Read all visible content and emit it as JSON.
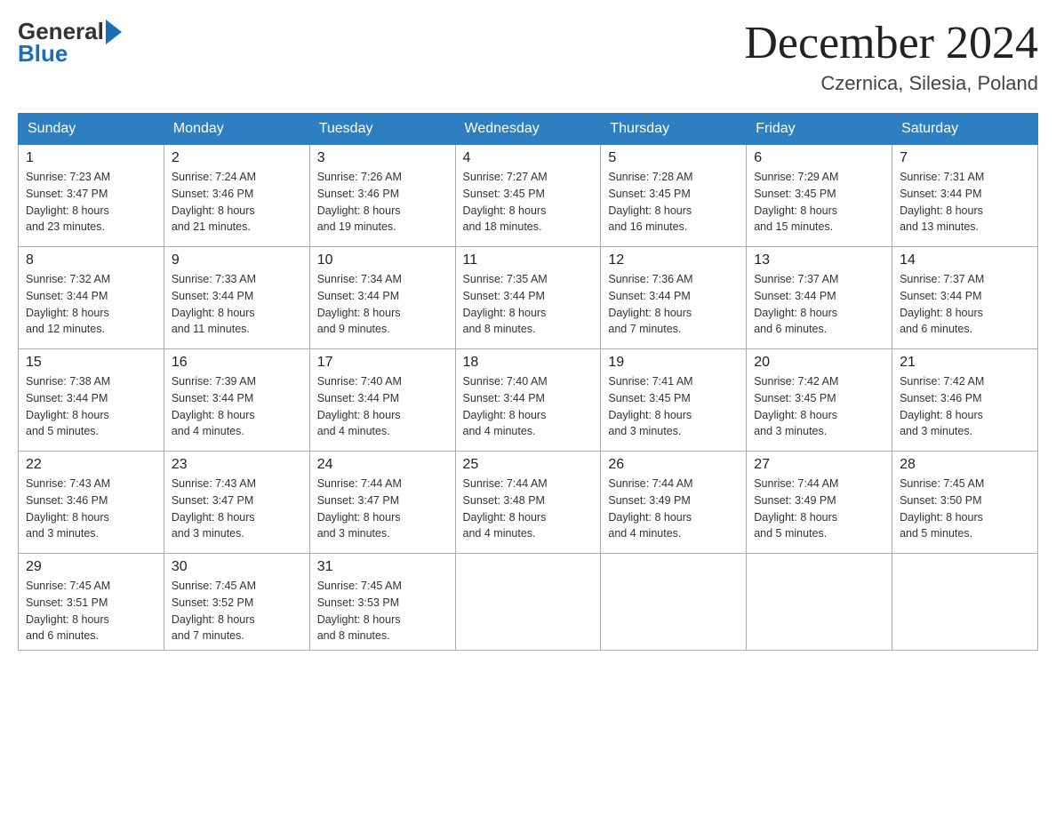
{
  "header": {
    "logo_general": "General",
    "logo_blue": "Blue",
    "title": "December 2024",
    "subtitle": "Czernica, Silesia, Poland"
  },
  "days_of_week": [
    "Sunday",
    "Monday",
    "Tuesday",
    "Wednesday",
    "Thursday",
    "Friday",
    "Saturday"
  ],
  "weeks": [
    [
      {
        "day": "1",
        "sunrise": "7:23 AM",
        "sunset": "3:47 PM",
        "daylight": "8 hours and 23 minutes."
      },
      {
        "day": "2",
        "sunrise": "7:24 AM",
        "sunset": "3:46 PM",
        "daylight": "8 hours and 21 minutes."
      },
      {
        "day": "3",
        "sunrise": "7:26 AM",
        "sunset": "3:46 PM",
        "daylight": "8 hours and 19 minutes."
      },
      {
        "day": "4",
        "sunrise": "7:27 AM",
        "sunset": "3:45 PM",
        "daylight": "8 hours and 18 minutes."
      },
      {
        "day": "5",
        "sunrise": "7:28 AM",
        "sunset": "3:45 PM",
        "daylight": "8 hours and 16 minutes."
      },
      {
        "day": "6",
        "sunrise": "7:29 AM",
        "sunset": "3:45 PM",
        "daylight": "8 hours and 15 minutes."
      },
      {
        "day": "7",
        "sunrise": "7:31 AM",
        "sunset": "3:44 PM",
        "daylight": "8 hours and 13 minutes."
      }
    ],
    [
      {
        "day": "8",
        "sunrise": "7:32 AM",
        "sunset": "3:44 PM",
        "daylight": "8 hours and 12 minutes."
      },
      {
        "day": "9",
        "sunrise": "7:33 AM",
        "sunset": "3:44 PM",
        "daylight": "8 hours and 11 minutes."
      },
      {
        "day": "10",
        "sunrise": "7:34 AM",
        "sunset": "3:44 PM",
        "daylight": "8 hours and 9 minutes."
      },
      {
        "day": "11",
        "sunrise": "7:35 AM",
        "sunset": "3:44 PM",
        "daylight": "8 hours and 8 minutes."
      },
      {
        "day": "12",
        "sunrise": "7:36 AM",
        "sunset": "3:44 PM",
        "daylight": "8 hours and 7 minutes."
      },
      {
        "day": "13",
        "sunrise": "7:37 AM",
        "sunset": "3:44 PM",
        "daylight": "8 hours and 6 minutes."
      },
      {
        "day": "14",
        "sunrise": "7:37 AM",
        "sunset": "3:44 PM",
        "daylight": "8 hours and 6 minutes."
      }
    ],
    [
      {
        "day": "15",
        "sunrise": "7:38 AM",
        "sunset": "3:44 PM",
        "daylight": "8 hours and 5 minutes."
      },
      {
        "day": "16",
        "sunrise": "7:39 AM",
        "sunset": "3:44 PM",
        "daylight": "8 hours and 4 minutes."
      },
      {
        "day": "17",
        "sunrise": "7:40 AM",
        "sunset": "3:44 PM",
        "daylight": "8 hours and 4 minutes."
      },
      {
        "day": "18",
        "sunrise": "7:40 AM",
        "sunset": "3:44 PM",
        "daylight": "8 hours and 4 minutes."
      },
      {
        "day": "19",
        "sunrise": "7:41 AM",
        "sunset": "3:45 PM",
        "daylight": "8 hours and 3 minutes."
      },
      {
        "day": "20",
        "sunrise": "7:42 AM",
        "sunset": "3:45 PM",
        "daylight": "8 hours and 3 minutes."
      },
      {
        "day": "21",
        "sunrise": "7:42 AM",
        "sunset": "3:46 PM",
        "daylight": "8 hours and 3 minutes."
      }
    ],
    [
      {
        "day": "22",
        "sunrise": "7:43 AM",
        "sunset": "3:46 PM",
        "daylight": "8 hours and 3 minutes."
      },
      {
        "day": "23",
        "sunrise": "7:43 AM",
        "sunset": "3:47 PM",
        "daylight": "8 hours and 3 minutes."
      },
      {
        "day": "24",
        "sunrise": "7:44 AM",
        "sunset": "3:47 PM",
        "daylight": "8 hours and 3 minutes."
      },
      {
        "day": "25",
        "sunrise": "7:44 AM",
        "sunset": "3:48 PM",
        "daylight": "8 hours and 4 minutes."
      },
      {
        "day": "26",
        "sunrise": "7:44 AM",
        "sunset": "3:49 PM",
        "daylight": "8 hours and 4 minutes."
      },
      {
        "day": "27",
        "sunrise": "7:44 AM",
        "sunset": "3:49 PM",
        "daylight": "8 hours and 5 minutes."
      },
      {
        "day": "28",
        "sunrise": "7:45 AM",
        "sunset": "3:50 PM",
        "daylight": "8 hours and 5 minutes."
      }
    ],
    [
      {
        "day": "29",
        "sunrise": "7:45 AM",
        "sunset": "3:51 PM",
        "daylight": "8 hours and 6 minutes."
      },
      {
        "day": "30",
        "sunrise": "7:45 AM",
        "sunset": "3:52 PM",
        "daylight": "8 hours and 7 minutes."
      },
      {
        "day": "31",
        "sunrise": "7:45 AM",
        "sunset": "3:53 PM",
        "daylight": "8 hours and 8 minutes."
      },
      null,
      null,
      null,
      null
    ]
  ],
  "labels": {
    "sunrise": "Sunrise:",
    "sunset": "Sunset:",
    "daylight": "Daylight:"
  }
}
